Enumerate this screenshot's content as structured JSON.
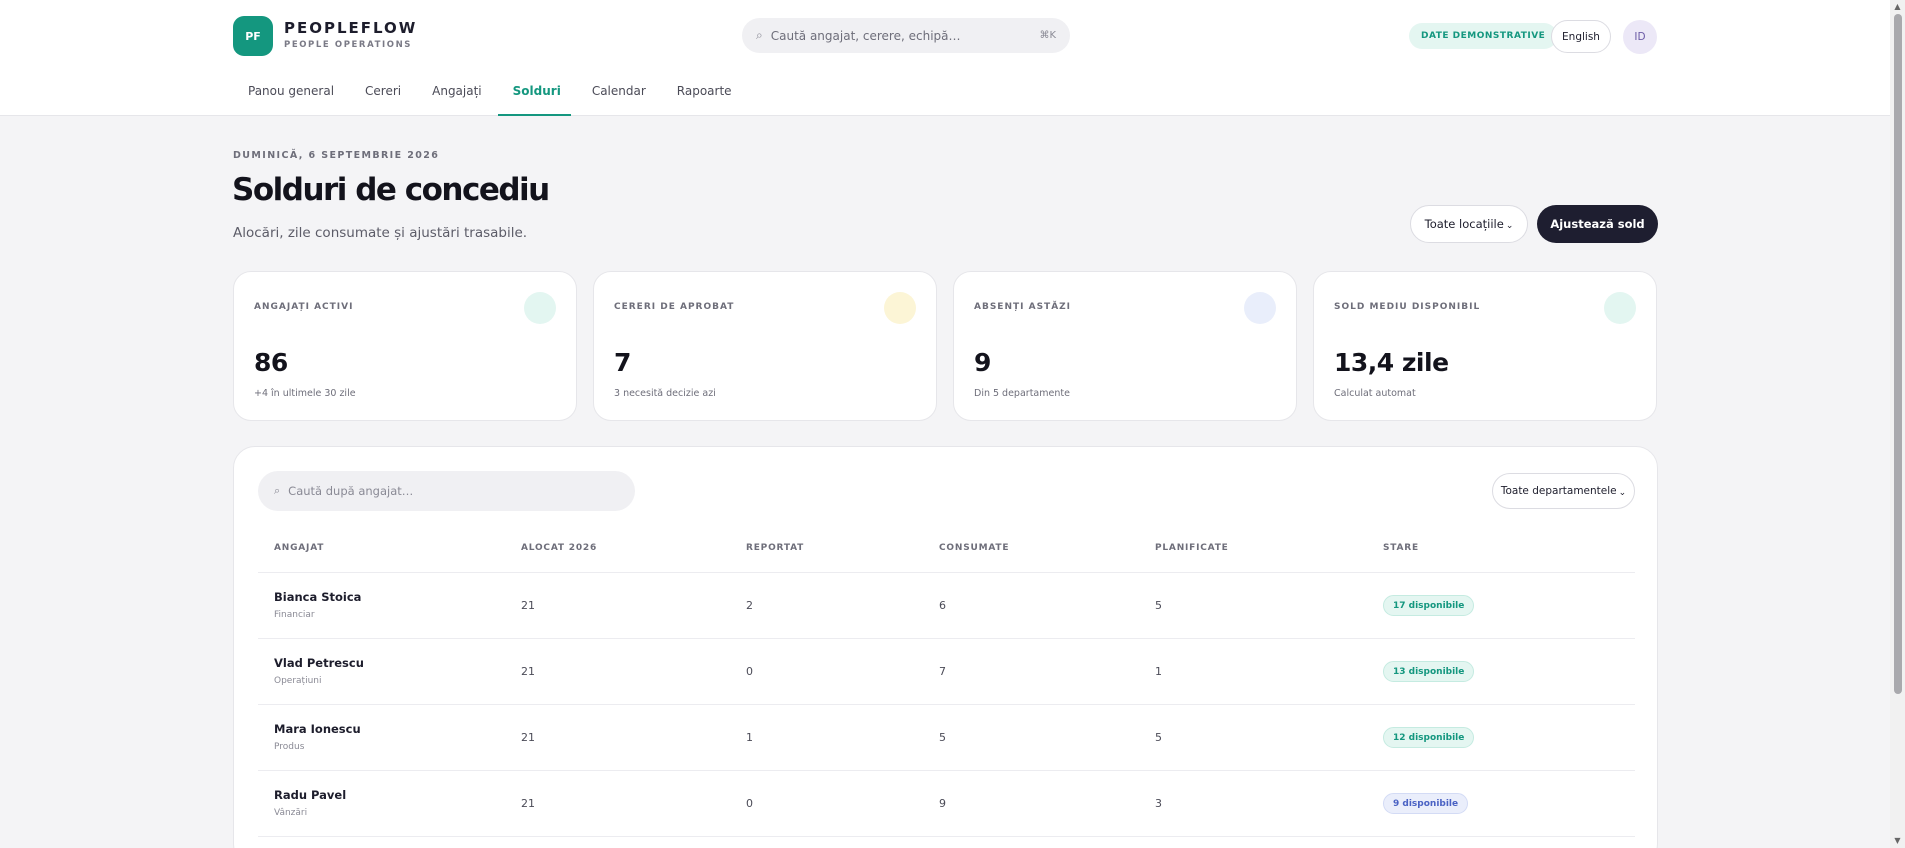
{
  "brand": {
    "badge": "PF",
    "name": "PEOPLEFLOW",
    "subtitle": "PEOPLE OPERATIONS"
  },
  "global_search": {
    "placeholder": "Caută angajat, cerere, echipă…",
    "shortcut": "⌘K"
  },
  "header": {
    "demo_badge": "DATE DEMONSTRATIVE",
    "language_button": "English",
    "avatar_initials": "ID"
  },
  "nav": {
    "tabs": [
      {
        "label": "Panou general",
        "active": false
      },
      {
        "label": "Cereri",
        "active": false
      },
      {
        "label": "Angajați",
        "active": false
      },
      {
        "label": "Solduri",
        "active": true
      },
      {
        "label": "Calendar",
        "active": false
      },
      {
        "label": "Rapoarte",
        "active": false
      }
    ]
  },
  "page": {
    "date": "DUMINICĂ, 6 SEPTEMBRIE 2026",
    "title": "Solduri de concediu",
    "subtitle": "Alocări, zile consumate și ajustări trasabile.",
    "location_filter": "Toate locațiile",
    "adjust_button": "Ajustează sold"
  },
  "stats": [
    {
      "label": "ANGAJAȚI ACTIVI",
      "value": "86",
      "note": "+4 în ultimele 30 zile",
      "dot_color": "#e3f6f1"
    },
    {
      "label": "CERERI DE APROBAT",
      "value": "7",
      "note": "3 necesită decizie azi",
      "dot_color": "#fcf5d6"
    },
    {
      "label": "ABSENȚI ASTĂZI",
      "value": "9",
      "note": "Din 5 departamente",
      "dot_color": "#e9eefb"
    },
    {
      "label": "SOLD MEDIU DISPONIBIL",
      "value": "13,4 zile",
      "note": "Calculat automat",
      "dot_color": "#e3f6f1"
    }
  ],
  "table": {
    "search_placeholder": "Caută după angajat…",
    "department_filter": "Toate departamentele",
    "columns": [
      "ANGAJAT",
      "ALOCAT 2026",
      "REPORTAT",
      "CONSUMATE",
      "PLANIFICATE",
      "STARE"
    ],
    "rows": [
      {
        "name": "Bianca Stoica",
        "dept": "Financiar",
        "allocated": "21",
        "carried": "2",
        "used": "6",
        "planned": "5",
        "status": "17 disponibile",
        "status_kind": "green"
      },
      {
        "name": "Vlad Petrescu",
        "dept": "Operațiuni",
        "allocated": "21",
        "carried": "0",
        "used": "7",
        "planned": "1",
        "status": "13 disponibile",
        "status_kind": "green"
      },
      {
        "name": "Mara Ionescu",
        "dept": "Produs",
        "allocated": "21",
        "carried": "1",
        "used": "5",
        "planned": "5",
        "status": "12 disponibile",
        "status_kind": "green"
      },
      {
        "name": "Radu Pavel",
        "dept": "Vânzări",
        "allocated": "21",
        "carried": "0",
        "used": "9",
        "planned": "3",
        "status": "9 disponibile",
        "status_kind": "blue"
      }
    ]
  },
  "colors": {
    "accent": "#14977f",
    "dark_button": "#1e1e30",
    "green_pill_bg": "#e4f6f1",
    "green_pill_text": "#14977f",
    "blue_pill_bg": "#eaeefb",
    "blue_pill_text": "#4a62c4"
  },
  "icons": {
    "search": "search-icon",
    "chevron": "chevron-down-icon"
  }
}
